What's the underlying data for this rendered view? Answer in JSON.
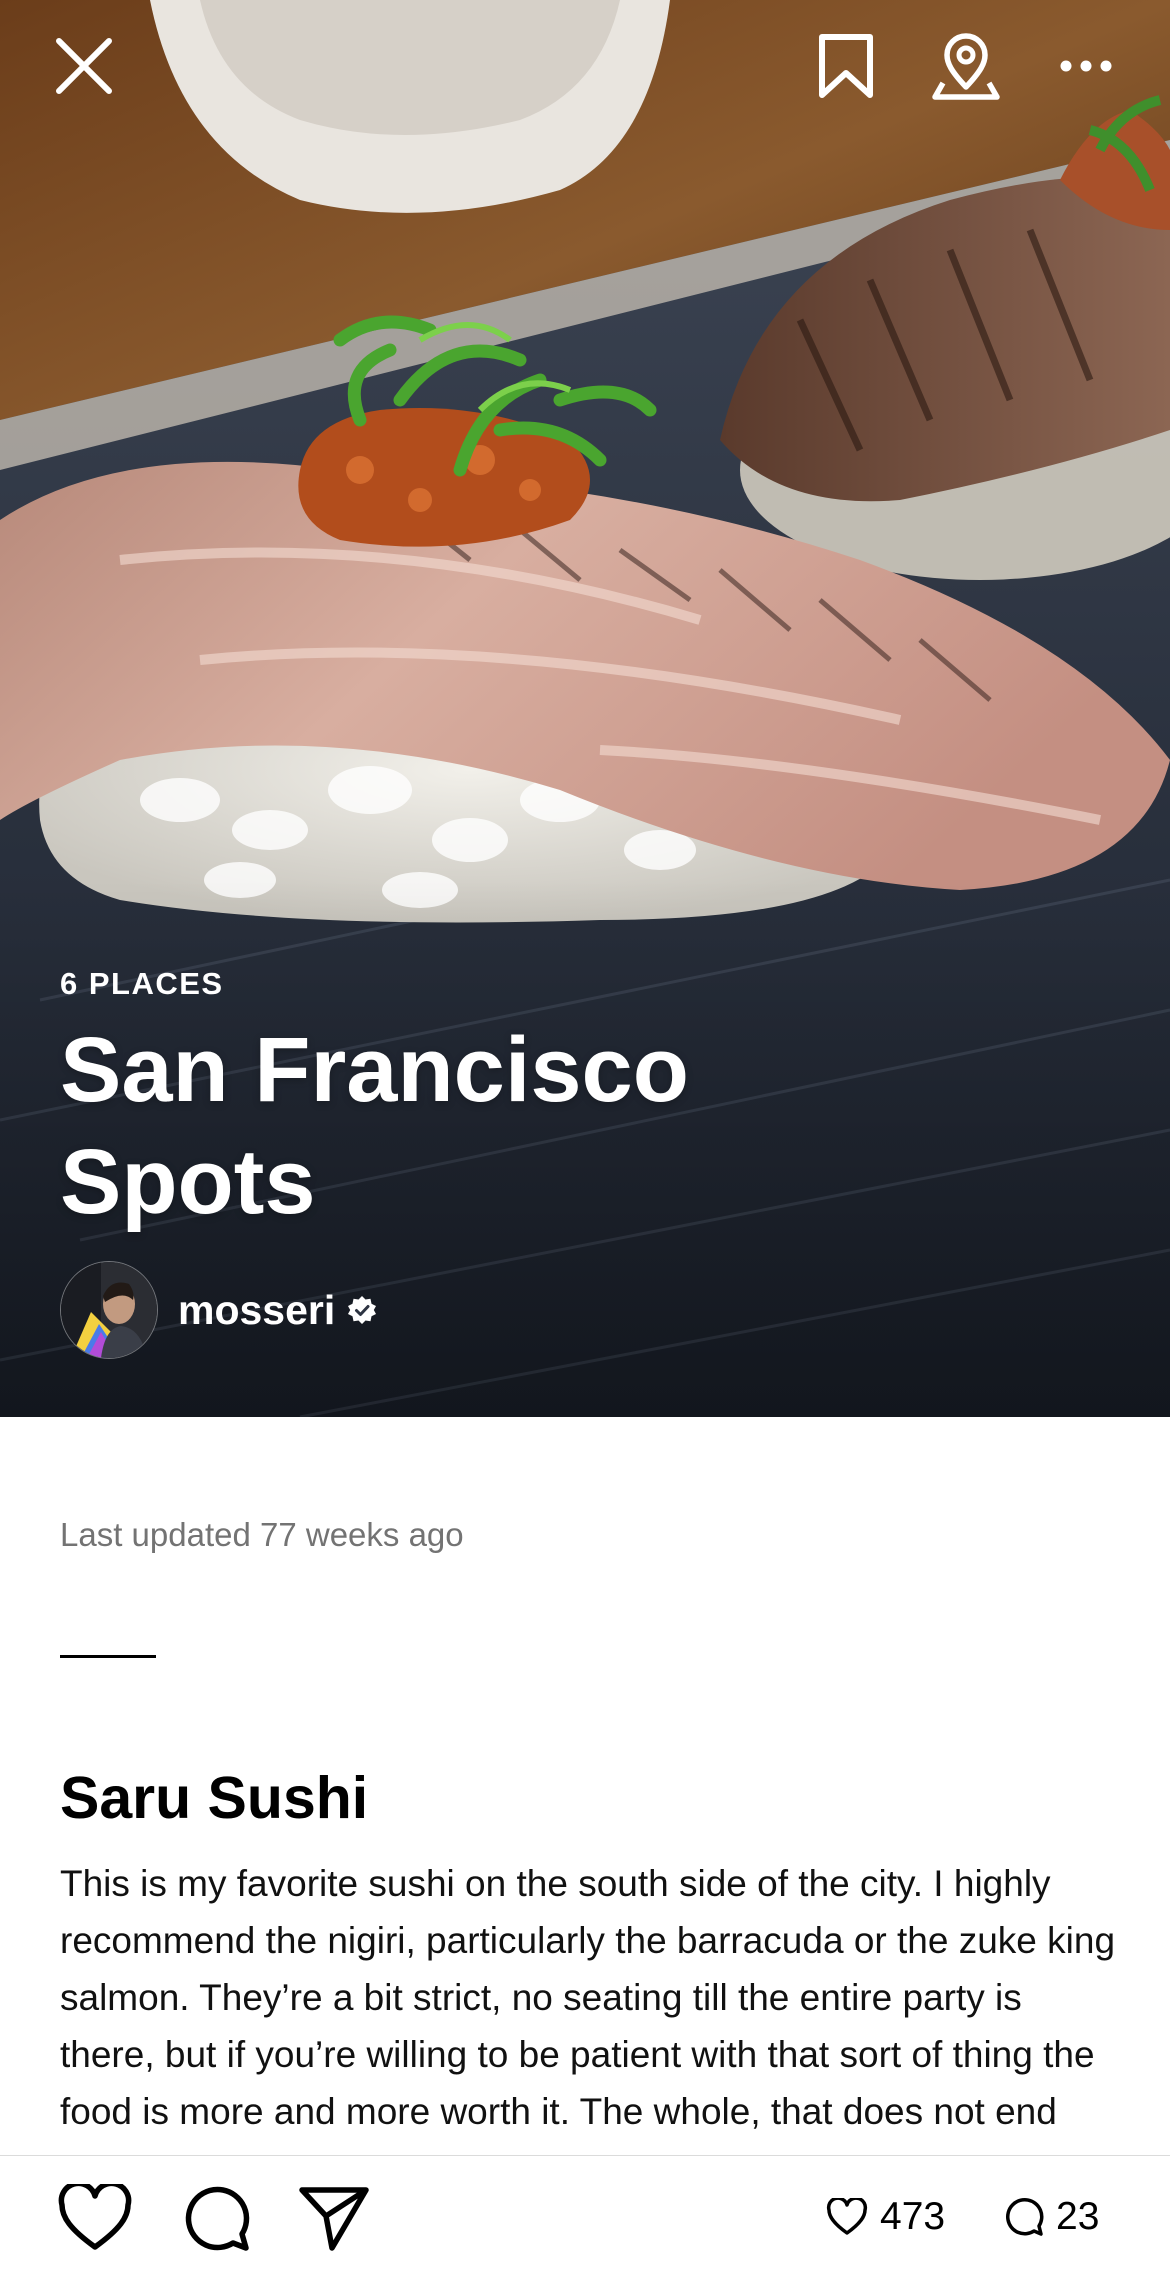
{
  "header": {
    "close_icon": "close-icon",
    "save_icon": "bookmark-icon",
    "map_icon": "map-pin-icon",
    "more_icon": "more-horizontal-icon"
  },
  "guide": {
    "places_count": "6 PLACES",
    "title": "San Francisco Spots",
    "author": "mosseri",
    "verified_icon": "verified-badge-icon",
    "last_updated": "Last updated 77 weeks ago"
  },
  "place": {
    "name": "Saru Sushi",
    "description": "This is my favorite sushi on the south side of the city. I highly recommend the nigiri, particularly the barracuda or the zuke king salmon. They’re a bit strict, no seating till the entire party is there, but if you’re willing to be patient with that sort of thing the food is more and more worth it. The whole, that does not end"
  },
  "actions": {
    "like_icon": "heart-icon",
    "comment_icon": "comment-icon",
    "share_icon": "send-icon",
    "likes_count": "473",
    "comments_count": "23"
  },
  "colors": {
    "text_primary": "#000000",
    "text_secondary": "#737373",
    "hero_text": "#ffffff"
  }
}
